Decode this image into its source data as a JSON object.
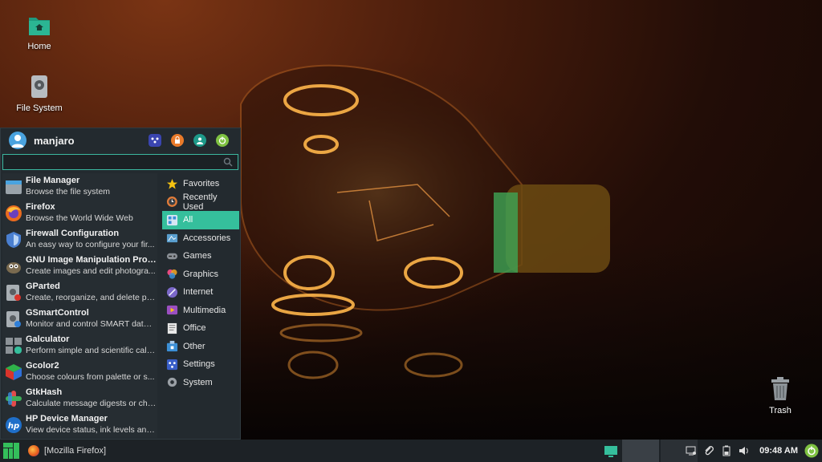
{
  "desktop": {
    "icons": [
      {
        "label": "Home",
        "icon": "home-folder-icon"
      },
      {
        "label": "File System",
        "icon": "drive-icon"
      },
      {
        "label": "Trash",
        "icon": "trash-icon"
      }
    ]
  },
  "menu": {
    "username": "manjaro",
    "header_buttons": [
      "settings-manager-icon",
      "lock-screen-icon",
      "switch-user-icon",
      "logout-icon"
    ],
    "search": {
      "value": "",
      "placeholder": ""
    },
    "apps": [
      {
        "name": "File Manager",
        "desc": "Browse the file system",
        "icon": "file-manager-icon"
      },
      {
        "name": "Firefox",
        "desc": "Browse the World Wide Web",
        "icon": "firefox-icon"
      },
      {
        "name": "Firewall Configuration",
        "desc": "An easy way to configure your fir...",
        "icon": "firewall-icon"
      },
      {
        "name": "GNU Image Manipulation Prog...",
        "desc": "Create images and edit photogra...",
        "icon": "gimp-icon"
      },
      {
        "name": "GParted",
        "desc": "Create, reorganize, and delete pa...",
        "icon": "gparted-icon"
      },
      {
        "name": "GSmartControl",
        "desc": "Monitor and control SMART data ...",
        "icon": "gsmartcontrol-icon"
      },
      {
        "name": "Galculator",
        "desc": "Perform simple and scientific calc...",
        "icon": "calculator-icon"
      },
      {
        "name": "Gcolor2",
        "desc": "Choose colours from palette or s...",
        "icon": "color-picker-icon"
      },
      {
        "name": "GtkHash",
        "desc": "Calculate message digests or che...",
        "icon": "hash-icon"
      },
      {
        "name": "HP Device Manager",
        "desc": "View device status, ink levels and ...",
        "icon": "hp-icon"
      }
    ],
    "categories": [
      {
        "label": "Favorites",
        "icon": "star-icon",
        "color": "#f5c211"
      },
      {
        "label": "Recently Used",
        "icon": "recent-icon",
        "color": "#e07b39"
      },
      {
        "label": "All",
        "icon": "all-apps-icon",
        "color": "#3a8fd9",
        "active": true
      },
      {
        "label": "Accessories",
        "icon": "accessories-icon",
        "color": "#5a9fcf"
      },
      {
        "label": "Games",
        "icon": "gamepad-icon",
        "color": "#8a8f95"
      },
      {
        "label": "Graphics",
        "icon": "graphics-icon",
        "color": "#e84a7f"
      },
      {
        "label": "Internet",
        "icon": "internet-icon",
        "color": "#7b68c9"
      },
      {
        "label": "Multimedia",
        "icon": "multimedia-icon",
        "color": "#9b4fc1"
      },
      {
        "label": "Office",
        "icon": "office-icon",
        "color": "#e8e8e8"
      },
      {
        "label": "Other",
        "icon": "other-icon",
        "color": "#3b8fd6"
      },
      {
        "label": "Settings",
        "icon": "settings-icon",
        "color": "#3a5fc9"
      },
      {
        "label": "System",
        "icon": "system-icon",
        "color": "#9aa0a6"
      }
    ]
  },
  "taskbar": {
    "task_label": "[Mozilla Firefox]",
    "clock": "09:48 AM",
    "accent": "#35bf9c"
  }
}
